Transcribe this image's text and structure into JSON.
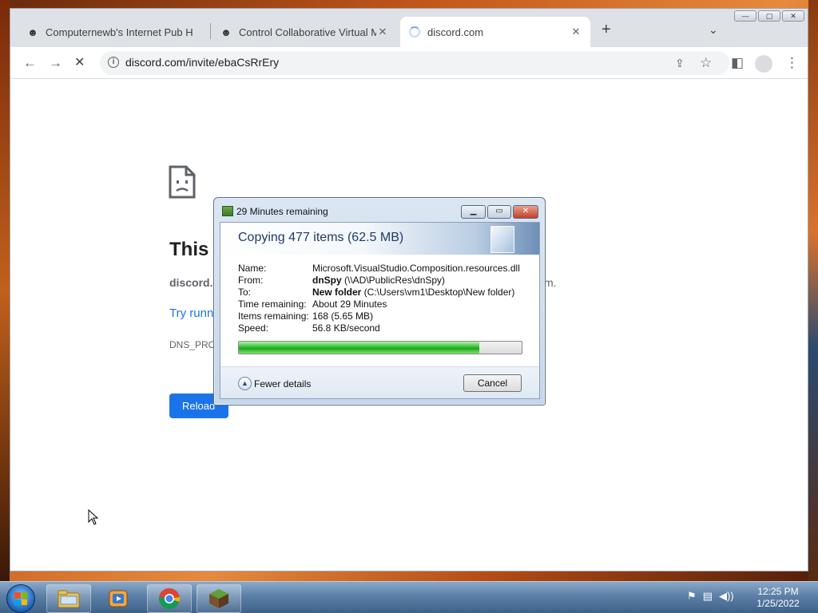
{
  "browser": {
    "tabs": [
      {
        "title": "Computernewb's Internet Pub H",
        "icon": "cat-head-icon"
      },
      {
        "title": "Control Collaborative Virtual Ma",
        "icon": "cat-head-icon"
      },
      {
        "title": "discord.com",
        "icon": "loading-spinner-icon",
        "active": true
      }
    ],
    "new_tab": "+",
    "url": "discord.com/invite/ebaCsRrEry",
    "window_controls": {
      "minimize": "—",
      "maximize": "▢",
      "close": "✕"
    }
  },
  "error_page": {
    "title_visible": "This s",
    "host_visible": "discord.",
    "host_tail_visible": "m.",
    "try_visible": "Try runn",
    "code_visible": "DNS_PROB",
    "reload_label": "Reload"
  },
  "copy_dialog": {
    "window_title": "29 Minutes remaining",
    "heading": "Copying 477 items (62.5 MB)",
    "rows": {
      "name_label": "Name:",
      "name_value": "Microsoft.VisualStudio.Composition.resources.dll",
      "from_label": "From:",
      "from_bold": "dnSpy",
      "from_rest": " (\\\\AD\\PublicRes\\dnSpy)",
      "to_label": "To:",
      "to_bold": "New folder",
      "to_rest": " (C:\\Users\\vm1\\Desktop\\New folder)",
      "time_label": "Time remaining:",
      "time_value": "About 29 Minutes",
      "items_label": "Items remaining:",
      "items_value": "168 (5.65 MB)",
      "speed_label": "Speed:",
      "speed_value": "56.8 KB/second"
    },
    "progress_fraction": 0.85,
    "fewer_details": "Fewer details",
    "cancel": "Cancel",
    "accent": "#1ea31a"
  },
  "taskbar": {
    "apps": [
      "windows-explorer-icon",
      "media-player-icon",
      "chrome-icon",
      "minecraft-icon"
    ],
    "time": "12:25 PM",
    "date": "1/25/2022"
  }
}
